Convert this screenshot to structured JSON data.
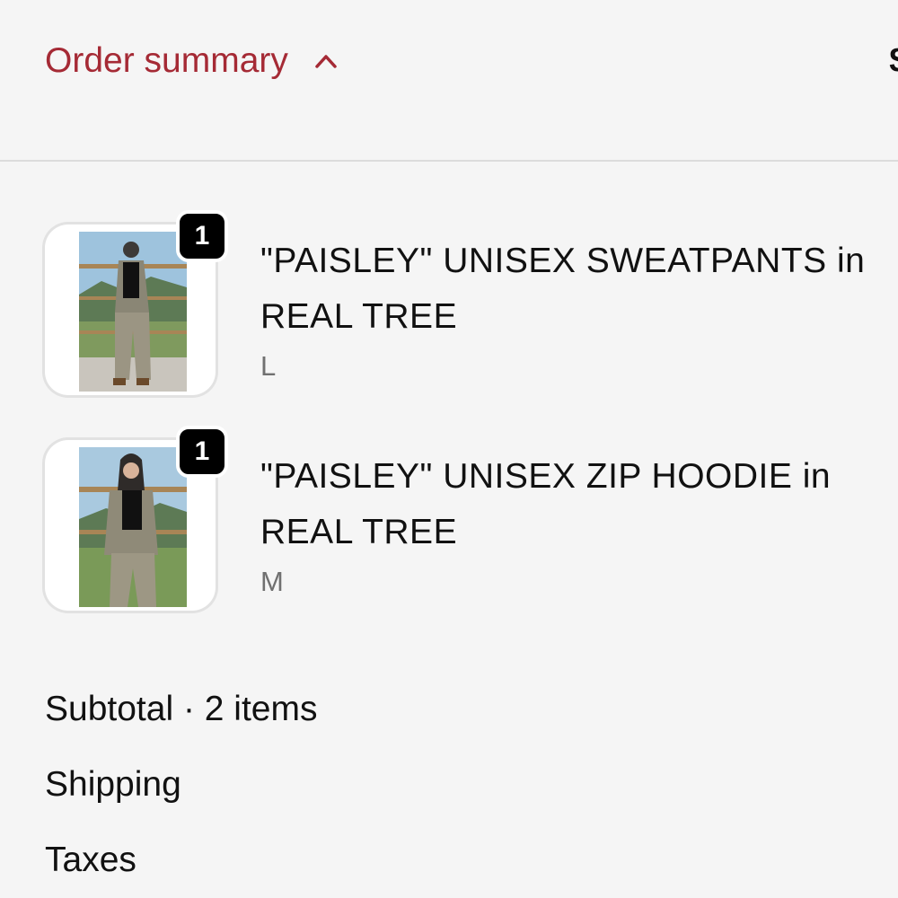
{
  "summary": {
    "toggle_label": "Order summary",
    "toggle_icon": "chevron-up-icon",
    "accent_color": "#a52a35",
    "edge_text": "$"
  },
  "items": [
    {
      "quantity": "1",
      "title": "\"PAISLEY\" UNISEX SWEATPANTS in REAL TREE",
      "variant": "L"
    },
    {
      "quantity": "1",
      "title": "\"PAISLEY\" UNISEX ZIP HOODIE in REAL TREE",
      "variant": "M"
    }
  ],
  "totals": {
    "subtotal_label": "Subtotal · 2 items",
    "shipping_label": "Shipping",
    "taxes_label": "Taxes"
  }
}
